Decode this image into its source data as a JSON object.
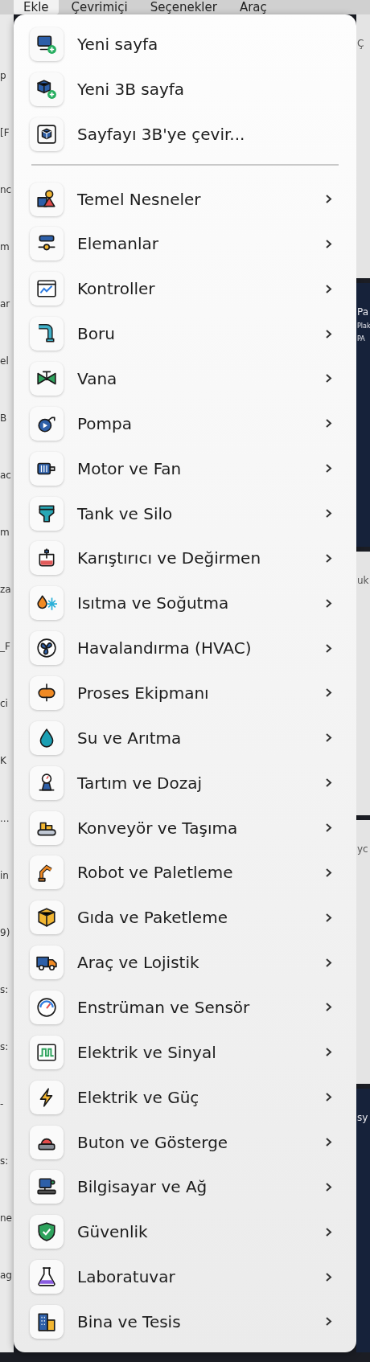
{
  "menubar": [
    {
      "label": "Ekle",
      "selected": true
    },
    {
      "label": "Çevrimiçi",
      "selected": false
    },
    {
      "label": "Seçenekler",
      "selected": false
    },
    {
      "label": "Araç",
      "selected": false
    }
  ],
  "left_edge": [
    "p",
    "[F",
    "nc",
    "m",
    "ar",
    "el",
    "B",
    "ac",
    "m",
    "za",
    "_F",
    "ci",
    "K",
    "...",
    "in",
    "9)",
    "s:",
    "s:",
    "-",
    "s:",
    "ne",
    "ag"
  ],
  "right_edge": [
    {
      "kind": "light",
      "texts": [
        "Ç"
      ]
    },
    {
      "kind": "dark",
      "texts": [
        "Pa",
        "Plak",
        "PA"
      ]
    },
    {
      "kind": "light",
      "texts": [
        "uk"
      ]
    },
    {
      "kind": "light",
      "texts": [
        "yc"
      ]
    },
    {
      "kind": "dark",
      "texts": [
        "sy"
      ]
    }
  ],
  "menu": {
    "sections": [
      {
        "items": [
          {
            "label": "Yeni sayfa",
            "kind": "action"
          },
          {
            "label": "Yeni 3B sayfa",
            "kind": "action"
          },
          {
            "label": "Sayfayı 3B'ye çevir...",
            "kind": "action"
          }
        ]
      },
      {
        "items": [
          {
            "label": "Temel Nesneler",
            "kind": "submenu"
          },
          {
            "label": "Elemanlar",
            "kind": "submenu"
          },
          {
            "label": "Kontroller",
            "kind": "submenu"
          },
          {
            "label": "Boru",
            "kind": "submenu"
          },
          {
            "label": "Vana",
            "kind": "submenu"
          },
          {
            "label": "Pompa",
            "kind": "submenu"
          },
          {
            "label": "Motor ve Fan",
            "kind": "submenu"
          },
          {
            "label": "Tank ve Silo",
            "kind": "submenu"
          },
          {
            "label": "Karıştırıcı ve Değirmen",
            "kind": "submenu"
          },
          {
            "label": "Isıtma ve Soğutma",
            "kind": "submenu"
          },
          {
            "label": "Havalandırma (HVAC)",
            "kind": "submenu"
          },
          {
            "label": "Proses Ekipmanı",
            "kind": "submenu"
          },
          {
            "label": "Su ve Arıtma",
            "kind": "submenu"
          },
          {
            "label": "Tartım ve Dozaj",
            "kind": "submenu"
          },
          {
            "label": "Konveyör ve Taşıma",
            "kind": "submenu"
          },
          {
            "label": "Robot ve Paletleme",
            "kind": "submenu"
          },
          {
            "label": "Gıda ve Paketleme",
            "kind": "submenu"
          },
          {
            "label": "Araç ve Lojistik",
            "kind": "submenu"
          },
          {
            "label": "Enstrüman ve Sensör",
            "kind": "submenu"
          },
          {
            "label": "Elektrik ve Sinyal",
            "kind": "submenu"
          },
          {
            "label": "Elektrik ve Güç",
            "kind": "submenu"
          },
          {
            "label": "Buton ve Gösterge",
            "kind": "submenu"
          },
          {
            "label": "Bilgisayar ve Ağ",
            "kind": "submenu"
          },
          {
            "label": "Güvenlik",
            "kind": "submenu"
          },
          {
            "label": "Laboratuvar",
            "kind": "submenu"
          },
          {
            "label": "Bina ve Tesis",
            "kind": "submenu"
          }
        ]
      }
    ]
  }
}
